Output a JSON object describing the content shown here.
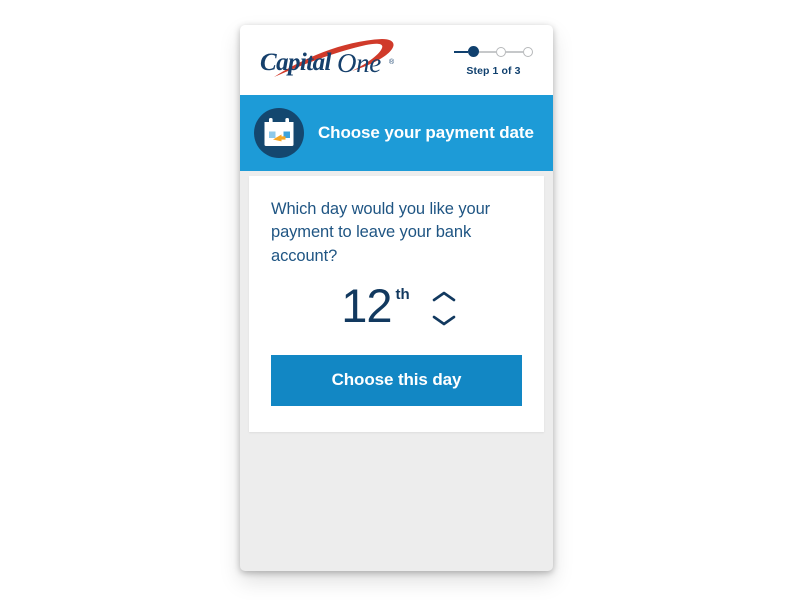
{
  "brand": {
    "name": "Capital One",
    "word_capital": "Capital",
    "word_one": "One",
    "trademark": "®",
    "logo_blue": "#16406c",
    "logo_red": "#d03a2a"
  },
  "progress": {
    "label": "Step 1 of 3",
    "current": 1,
    "total": 3,
    "active_color": "#10406e",
    "inactive_color": "#c6c8ca"
  },
  "section": {
    "title": "Choose your payment date",
    "icon": "calendar-icon",
    "band_color": "#1d9bd7",
    "icon_circle_color": "#14476f",
    "icon_accent_color": "#f5a623"
  },
  "content": {
    "question": "Which day would you like your payment to leave your bank account?",
    "question_color": "#1f5583"
  },
  "day_picker": {
    "value": "12",
    "ordinal_suffix": "th",
    "increment_icon": "chevron-up-icon",
    "decrement_icon": "chevron-down-icon",
    "text_color": "#12395f"
  },
  "cta": {
    "label": "Choose this day",
    "color": "#1287c4"
  }
}
